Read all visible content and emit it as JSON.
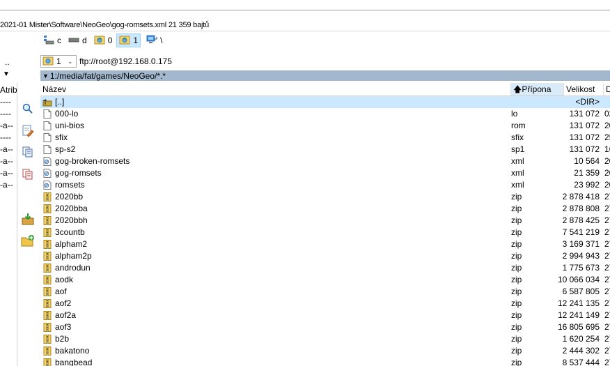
{
  "status": {
    "file_info": "2021-01 Mister\\Software\\NeoGeo\\gog-romsets.xml  21 359 bajtů"
  },
  "drives": [
    {
      "label": "c",
      "icon": "network-drive-icon",
      "active": false
    },
    {
      "label": "d",
      "icon": "hard-drive-icon",
      "active": false
    },
    {
      "label": "0",
      "icon": "ftp-connection-icon",
      "active": false
    },
    {
      "label": "1",
      "icon": "ftp-connection-icon",
      "active": true
    },
    {
      "label": "\\",
      "icon": "network-neighborhood-icon",
      "active": false
    }
  ],
  "path_bar": {
    "combo_value": "1",
    "connection": "ftp://root@192.168.0.175"
  },
  "current_path": "1:/media/fat/games/NeoGeo/*.*",
  "columns": {
    "name": "Název",
    "ext": "Přípona",
    "size": "Velikost",
    "date": "D"
  },
  "left_panel": {
    "dots": "..",
    "atrib_header": "Atrib",
    "attribs": [
      "----",
      "----",
      "-a--",
      "----",
      "-a--",
      "-a--",
      "-a--",
      "-a--"
    ]
  },
  "colors": {
    "selection": "#cce8ff",
    "path_header": "#a3b8cc",
    "folder": "#e8c96a"
  },
  "files": [
    {
      "name": "[..]",
      "ext": "",
      "size": "<DIR>",
      "date": "",
      "icon": "parent-dir-icon",
      "selected": true
    },
    {
      "name": "000-lo",
      "ext": "lo",
      "size": "131 072",
      "date": "02",
      "icon": "file-icon"
    },
    {
      "name": "uni-bios",
      "ext": "rom",
      "size": "131 072",
      "date": "20",
      "icon": "file-icon"
    },
    {
      "name": "sfix",
      "ext": "sfix",
      "size": "131 072",
      "date": "25",
      "icon": "file-icon"
    },
    {
      "name": "sp-s2",
      "ext": "sp1",
      "size": "131 072",
      "date": "16",
      "icon": "file-icon"
    },
    {
      "name": "gog-broken-romsets",
      "ext": "xml",
      "size": "10 564",
      "date": "20",
      "icon": "xml-file-icon"
    },
    {
      "name": "gog-romsets",
      "ext": "xml",
      "size": "21 359",
      "date": "20",
      "icon": "xml-file-icon"
    },
    {
      "name": "romsets",
      "ext": "xml",
      "size": "23 992",
      "date": "20",
      "icon": "xml-file-icon"
    },
    {
      "name": "2020bb",
      "ext": "zip",
      "size": "2 878 418",
      "date": "27",
      "icon": "zip-icon"
    },
    {
      "name": "2020bba",
      "ext": "zip",
      "size": "2 878 808",
      "date": "27",
      "icon": "zip-icon"
    },
    {
      "name": "2020bbh",
      "ext": "zip",
      "size": "2 878 425",
      "date": "27",
      "icon": "zip-icon"
    },
    {
      "name": "3countb",
      "ext": "zip",
      "size": "7 541 219",
      "date": "27",
      "icon": "zip-icon"
    },
    {
      "name": "alpham2",
      "ext": "zip",
      "size": "3 169 371",
      "date": "27",
      "icon": "zip-icon"
    },
    {
      "name": "alpham2p",
      "ext": "zip",
      "size": "2 994 943",
      "date": "27",
      "icon": "zip-icon"
    },
    {
      "name": "androdun",
      "ext": "zip",
      "size": "1 775 673",
      "date": "27",
      "icon": "zip-icon"
    },
    {
      "name": "aodk",
      "ext": "zip",
      "size": "10 066 034",
      "date": "27",
      "icon": "zip-icon"
    },
    {
      "name": "aof",
      "ext": "zip",
      "size": "6 587 805",
      "date": "27",
      "icon": "zip-icon"
    },
    {
      "name": "aof2",
      "ext": "zip",
      "size": "12 241 135",
      "date": "27",
      "icon": "zip-icon"
    },
    {
      "name": "aof2a",
      "ext": "zip",
      "size": "12 241 149",
      "date": "27",
      "icon": "zip-icon"
    },
    {
      "name": "aof3",
      "ext": "zip",
      "size": "16 805 695",
      "date": "27",
      "icon": "zip-icon"
    },
    {
      "name": "b2b",
      "ext": "zip",
      "size": "1 620 254",
      "date": "27",
      "icon": "zip-icon"
    },
    {
      "name": "bakatono",
      "ext": "zip",
      "size": "2 444 302",
      "date": "27",
      "icon": "zip-icon"
    },
    {
      "name": "bangbead",
      "ext": "zip",
      "size": "8 537 444",
      "date": "27",
      "icon": "zip-icon"
    }
  ]
}
